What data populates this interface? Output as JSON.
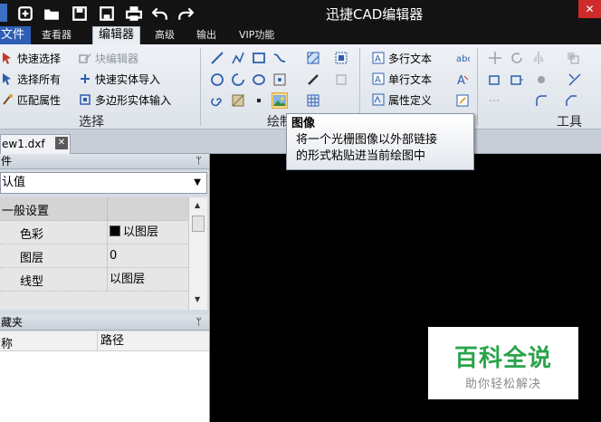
{
  "title_bar": {
    "title": "迅捷CAD编辑器",
    "close_glyph": "✕",
    "quick_access": [
      "new-icon",
      "open-icon",
      "save-icon",
      "save-as-icon",
      "print-icon",
      "undo-icon",
      "redo-icon"
    ]
  },
  "menu": {
    "file": "文件",
    "tabs": [
      "查看器",
      "编辑器",
      "高级",
      "输出",
      "VIP功能"
    ],
    "active_tab": "编辑器"
  },
  "ribbon": {
    "select_group": {
      "label": "选择",
      "quick_select": "快速选择",
      "select_all": "选择所有",
      "match_properties": "匹配属性",
      "block_editor": "块编辑器",
      "quick_entity_import": "快速实体导入",
      "polygon_entity_input": "多边形实体输入"
    },
    "draw_group": {
      "label": "绘制"
    },
    "text_group": {
      "mtext": "多行文本",
      "single_text": "单行文本",
      "attribute_define": "属性定义"
    },
    "tools_group": {
      "label": "工具"
    }
  },
  "tooltip": {
    "title": "图像",
    "body_line1": "将一个光栅图像以外部链接",
    "body_line2": "的形式粘贴进当前绘图中"
  },
  "document_tab": {
    "name": "ew1.dxf",
    "close": "✕"
  },
  "properties_panel": {
    "title": "件",
    "pin": "ᛘ",
    "dropdown_value": "认值",
    "category": "一般设置",
    "rows": [
      {
        "key": "色彩",
        "value": "以图层",
        "swatch": "#000000"
      },
      {
        "key": "图层",
        "value": "0"
      },
      {
        "key": "线型",
        "value": "以图层"
      }
    ]
  },
  "favorites_panel": {
    "title": "藏夹",
    "pin": "ᛘ",
    "col_name": "称",
    "col_path": "路径"
  },
  "watermark": {
    "main": "百科全说",
    "sub": "助你轻松解决"
  },
  "colors": {
    "title_bar": "#131313",
    "file_menu": "#2e5fb5",
    "ribbon": "#e6eaef",
    "canvas": "#000000",
    "watermark_green": "#2aa44a"
  }
}
